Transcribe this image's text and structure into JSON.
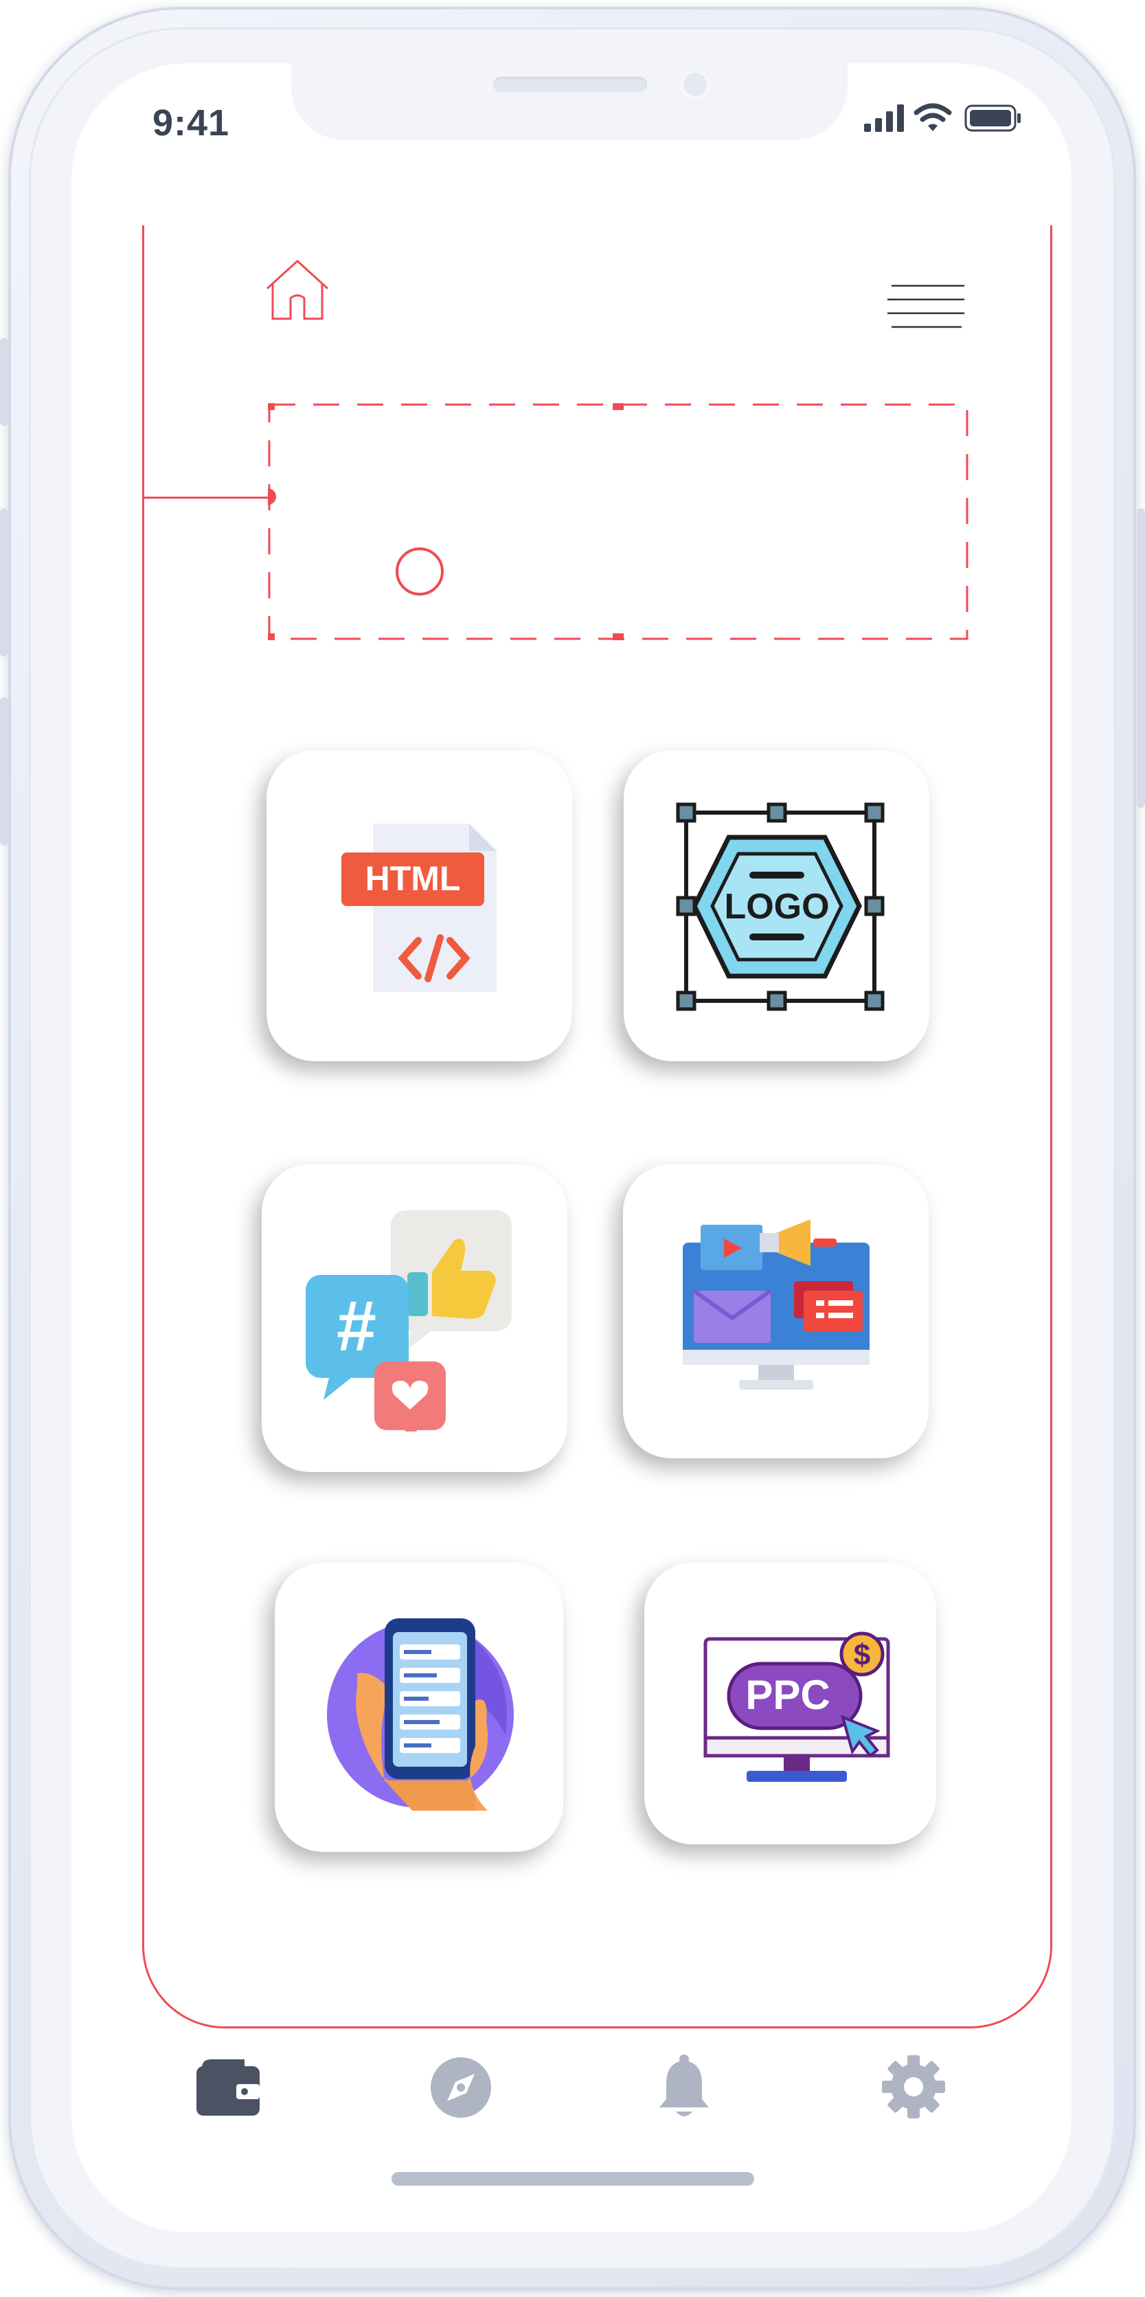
{
  "status_bar": {
    "time": "9:41"
  },
  "canvas": {
    "cards": [
      {
        "name": "html-card",
        "icon": "html-file-icon",
        "text": "HTML"
      },
      {
        "name": "logo-design-card",
        "icon": "logo-design-icon",
        "text": "LOGO"
      },
      {
        "name": "social-media-card",
        "icon": "social-media-icon",
        "text": "#"
      },
      {
        "name": "digital-marketing-card",
        "icon": "digital-marketing-icon"
      },
      {
        "name": "mobile-app-card",
        "icon": "mobile-app-icon"
      },
      {
        "name": "ppc-card",
        "icon": "ppc-monitor-icon",
        "text": "PPC"
      }
    ]
  },
  "tab_bar": {
    "items": [
      {
        "name": "wallet",
        "icon": "wallet-icon",
        "active": true
      },
      {
        "name": "explore",
        "icon": "compass-icon",
        "active": false
      },
      {
        "name": "notifications",
        "icon": "bell-icon",
        "active": false
      },
      {
        "name": "settings",
        "icon": "gear-icon",
        "active": false
      }
    ]
  },
  "colors": {
    "accent": "#ef4b55",
    "tab_active": "#4a5264",
    "tab_inactive": "#aeb4c3"
  }
}
